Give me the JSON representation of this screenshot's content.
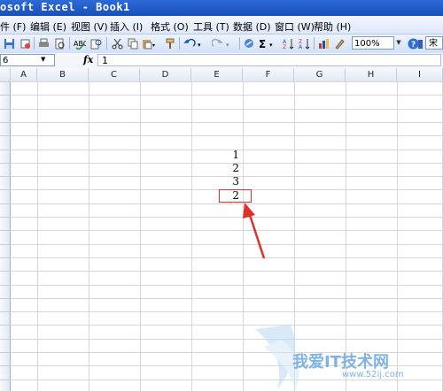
{
  "window": {
    "title": "osoft Excel - Book1"
  },
  "menu": [
    "件 (F)",
    "编辑 (E)",
    "视图 (V)",
    "插入 (I)",
    "格式 (O)",
    "工具 (T)",
    "数据 (D)",
    "窗口 (W)",
    "帮助 (H)"
  ],
  "toolbar": {
    "zoom": "100%",
    "font": "宋"
  },
  "formula_bar": {
    "name_box": "6",
    "fx_label": "fx",
    "value": "1"
  },
  "columns": [
    "A",
    "B",
    "C",
    "D",
    "E",
    "F",
    "G",
    "H",
    "I"
  ],
  "cells": [
    {
      "col": "E",
      "value": "1"
    },
    {
      "col": "E",
      "value": "2"
    },
    {
      "col": "E",
      "value": "3"
    },
    {
      "col": "E",
      "value": "2",
      "highlighted": true
    }
  ],
  "watermark": {
    "text": "我爱IT技术网",
    "url": "www.52ij.com"
  },
  "colors": {
    "highlight": "#e0302b",
    "title_bar": "#1a4fb8"
  }
}
